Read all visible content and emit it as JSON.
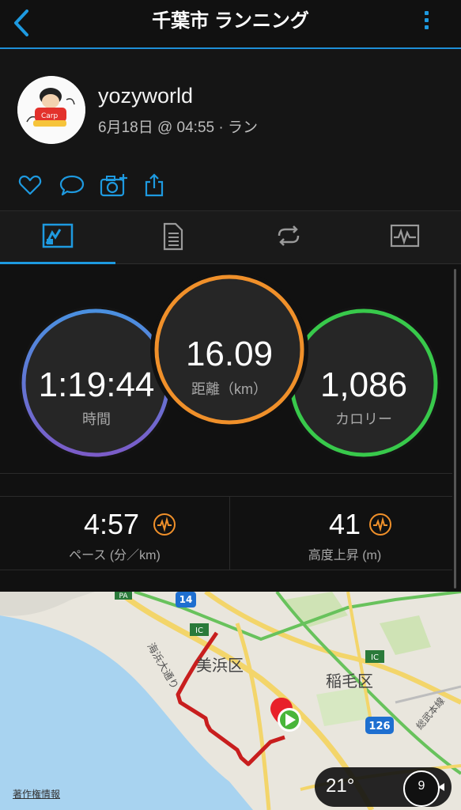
{
  "header": {
    "title": "千葉市 ランニング",
    "back_icon": "chevron-left-icon",
    "more_icon": "vertical-dots-icon"
  },
  "profile": {
    "username": "yozyworld",
    "subline": "6月18日 @ 04:55 · ラン"
  },
  "actions": {
    "like_icon": "heart-icon",
    "comment_icon": "comment-icon",
    "photo_icon": "camera-add-icon",
    "share_icon": "share-icon"
  },
  "tabs": [
    {
      "name": "overview",
      "icon": "stats-chart-icon",
      "selected": true
    },
    {
      "name": "details",
      "icon": "document-icon",
      "selected": false
    },
    {
      "name": "laps",
      "icon": "repeat-icon",
      "selected": false
    },
    {
      "name": "graphs",
      "icon": "pulse-graph-icon",
      "selected": false
    }
  ],
  "stats": {
    "time": {
      "value": "1:19:44",
      "label": "時間"
    },
    "distance": {
      "value": "16.09",
      "label": "距離（km）"
    },
    "calories": {
      "value": "1,086",
      "label": "カロリー"
    },
    "pace": {
      "value": "4:57",
      "label": "ペース (分／km)"
    },
    "ascent": {
      "value": "41",
      "label": "高度上昇 (m)"
    }
  },
  "colors": {
    "accent": "#1e9ae0",
    "time": "#5a7fd8",
    "distance": "#f0902a",
    "calories": "#38c94b",
    "route": "#c81e1e"
  },
  "map": {
    "labels": {
      "mihama": "美浜区",
      "inage": "稲毛区",
      "road_coast": "海浜大通り",
      "road_sobu": "総武本線",
      "route14": "14",
      "route126": "126",
      "ic1": "IC",
      "ic2": "IC",
      "pa": "PA"
    },
    "temperature": "21°",
    "wind": "9",
    "copyright": "著作権情報"
  }
}
